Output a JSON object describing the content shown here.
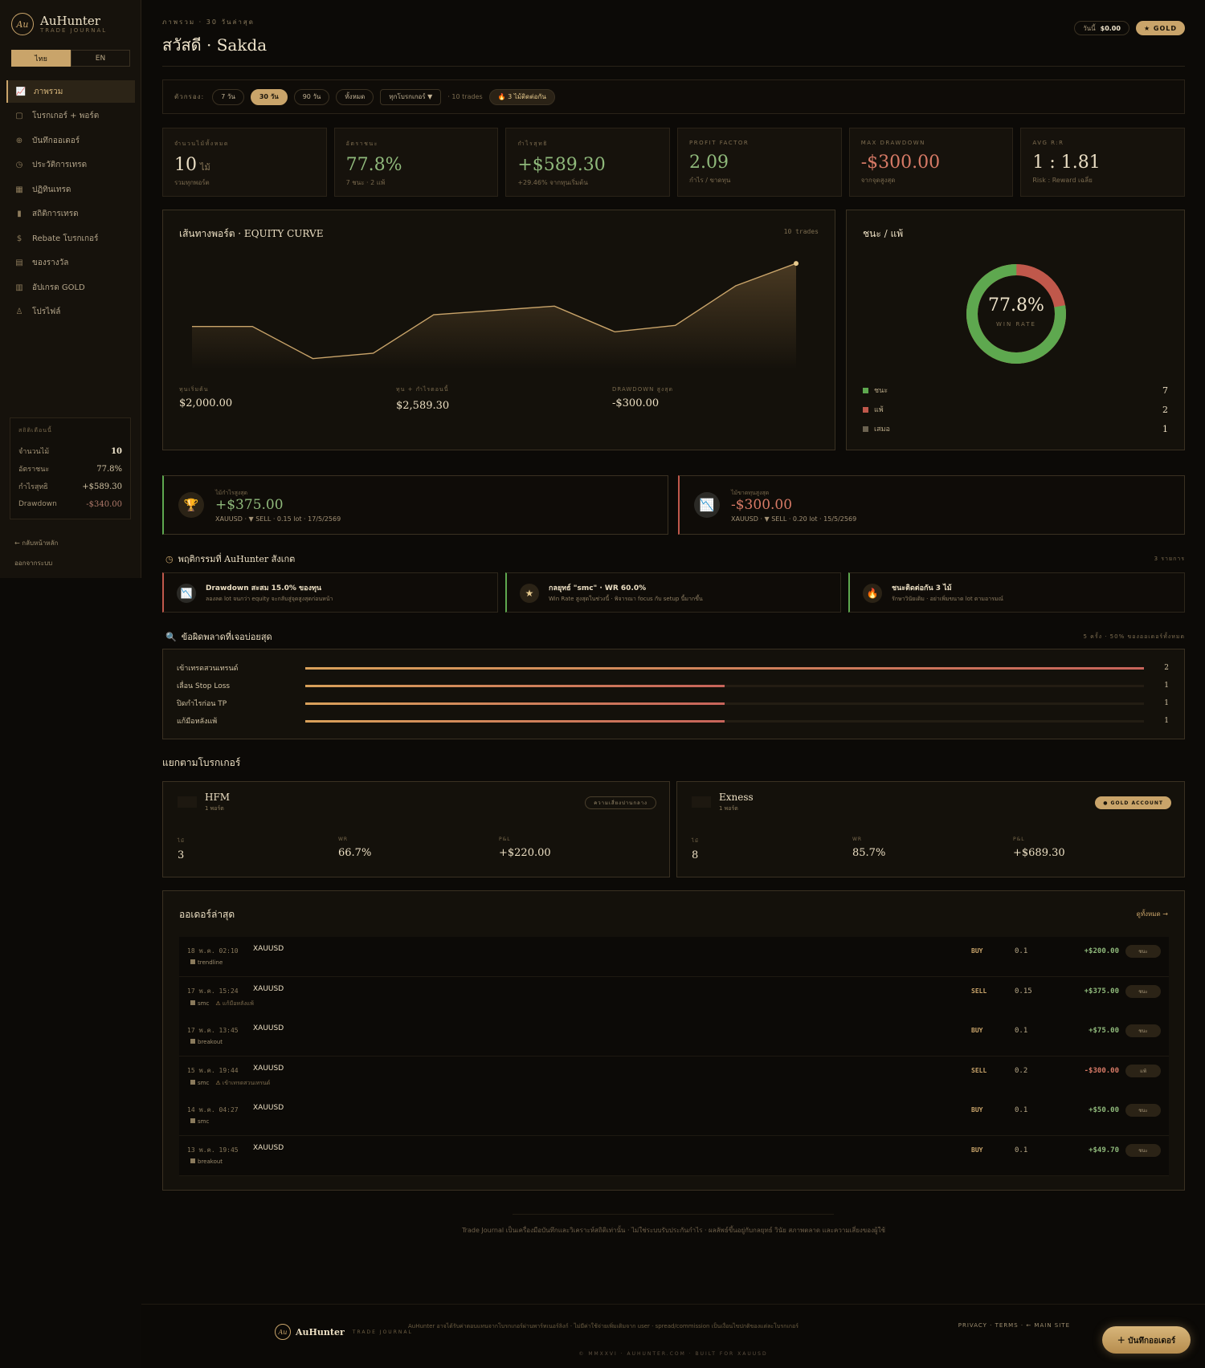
{
  "brand": {
    "name": "AuHunter",
    "sub": "TRADE JOURNAL",
    "logo": "Au"
  },
  "lang": {
    "th": "ไทย",
    "en": "EN"
  },
  "nav": [
    {
      "label": "ภาพรวม",
      "icon": "chart-line-icon",
      "glyph": "📈"
    },
    {
      "label": "โบรกเกอร์ + พอร์ต",
      "icon": "briefcase-icon",
      "glyph": "▢"
    },
    {
      "label": "บันทึกออเดอร์",
      "icon": "plus-circle-icon",
      "glyph": "⊕"
    },
    {
      "label": "ประวัติการเทรด",
      "icon": "clock-icon",
      "glyph": "◷"
    },
    {
      "label": "ปฏิทินเทรด",
      "icon": "calendar-icon",
      "glyph": "▦"
    },
    {
      "label": "สถิติการเทรด",
      "icon": "bar-chart-icon",
      "glyph": "▮"
    },
    {
      "label": "Rebate โบรกเกอร์",
      "icon": "dollar-circle-icon",
      "glyph": "$"
    },
    {
      "label": "ของรางวัล",
      "icon": "gift-icon",
      "glyph": "▤"
    },
    {
      "label": "อัปเกรด GOLD",
      "icon": "upgrade-gift-icon",
      "glyph": "▥"
    },
    {
      "label": "โปรไฟล์",
      "icon": "user-icon",
      "glyph": "♙"
    }
  ],
  "side_stats": {
    "title": "สถิติเดือนนี้",
    "rows": [
      {
        "k": "จำนวนไม้",
        "v": "10"
      },
      {
        "k": "อัตราชนะ",
        "v": "77.8%"
      },
      {
        "k": "กำไรสุทธิ",
        "v": "+$589.30"
      },
      {
        "k": "Drawdown",
        "v": "-$340.00"
      }
    ]
  },
  "side_links": {
    "back": "← กลับหน้าหลัก",
    "logout": "ออกจากระบบ"
  },
  "header": {
    "crumb": "ภาพรวม · 30 วันล่าสุด",
    "title": "สวัสดี · Sakda",
    "balance_label": "วันนี้",
    "balance": "$0.00",
    "tier": "★ GOLD"
  },
  "filters": {
    "label": "ตัวกรอง:",
    "ranges": [
      "7 วัน",
      "30 วัน",
      "90 วัน",
      "ทั้งหมด"
    ],
    "broker": "ทุกโบรกเกอร์ ▼",
    "count": "· 10 trades",
    "streak": "🔥 3 ไม้ติดต่อกัน"
  },
  "kpis": [
    {
      "label": "จำนวนไม้ทั้งหมด",
      "value": "10",
      "unit": "ไม้",
      "sub": "รวมทุกพอร์ต"
    },
    {
      "label": "อัตราชนะ",
      "value": "77.8%",
      "unit": "",
      "sub": "7 ชนะ · 2 แพ้"
    },
    {
      "label": "กำไรสุทธิ",
      "value": "+$589.30",
      "unit": "",
      "sub": "+29.46% จากทุนเริ่มต้น"
    },
    {
      "label": "PROFIT FACTOR",
      "value": "2.09",
      "unit": "",
      "sub": "กำไร / ขาดทุน"
    },
    {
      "label": "MAX DRAWDOWN",
      "value": "-$300.00",
      "unit": "",
      "sub": "จากจุดสูงสุด"
    },
    {
      "label": "AVG R:R",
      "value": "1 : 1.81",
      "unit": "",
      "sub": "Risk : Reward เฉลี่ย"
    }
  ],
  "equity": {
    "title": "เส้นทางพอร์ต · EQUITY CURVE",
    "count": "10 trades",
    "start_label": "ทุนเริ่มต้น",
    "start": "$2,000.00",
    "now_label": "ทุน + กำไรตอนนี้",
    "now": "$2,589.30",
    "dd_label": "DRAWDOWN สูงสุด",
    "dd": "-$300.00"
  },
  "chart_data": {
    "type": "area",
    "series": [
      {
        "values": [
          2000,
          2000,
          1700,
          1750,
          2110,
          2150,
          2190,
          1950,
          2010,
          2380,
          2589.3
        ]
      }
    ]
  },
  "winloss": {
    "title": "ชนะ / แพ้",
    "pct": "77.8%",
    "pct_label": "WIN RATE",
    "win_fraction": 0.778,
    "colors": {
      "win": "#5ea84f",
      "loss": "#c0584b",
      "draw": "#6b6250"
    },
    "rows": [
      {
        "k": "ชนะ",
        "v": "7"
      },
      {
        "k": "แพ้",
        "v": "2"
      },
      {
        "k": "เสมอ",
        "v": "1"
      }
    ]
  },
  "best": {
    "label": "ไม้กำไรสูงสุด",
    "value": "+$375.00",
    "sub": "XAUUSD · ▼ SELL · 0.15 lot · 17/5/2569"
  },
  "worst": {
    "label": "ไม้ขาดทุนสูงสุด",
    "value": "-$300.00",
    "sub": "XAUUSD · ▼ SELL · 0.20 lot · 15/5/2569"
  },
  "behavior": {
    "title": "พฤติกรรมที่ AuHunter สังเกต",
    "count": "3 รายการ",
    "items": [
      {
        "t": "Drawdown สะสม 15.0% ของทุน",
        "s": "ลองลด lot จนกว่า equity จะกลับสู่จุดสูงสุดก่อนหน้า"
      },
      {
        "t": "กลยุทธ์ \"smc\" · WR 60.0%",
        "s": "Win Rate สูงสุดในช่วงนี้ · พิจารณา focus กับ setup นี้มากขึ้น"
      },
      {
        "t": "ชนะติดต่อกัน 3 ไม้",
        "s": "รักษาวินัยเดิม · อย่าเพิ่มขนาด lot ตามอารมณ์"
      }
    ]
  },
  "mistakes": {
    "title": "ข้อผิดพลาดที่เจอบ่อยสุด",
    "count": "5 ครั้ง · 50% ของออเดอร์ทั้งหมด",
    "rows": [
      {
        "k": "เข้าเทรดสวนเทรนด์",
        "v": "2",
        "frac": 1.0
      },
      {
        "k": "เลื่อน Stop Loss",
        "v": "1",
        "frac": 0.5
      },
      {
        "k": "ปิดกำไรก่อน TP",
        "v": "1",
        "frac": 0.5
      },
      {
        "k": "แก้มือหลังแพ้",
        "v": "1",
        "frac": 0.5
      }
    ]
  },
  "brokers": {
    "title": "แยกตามโบรกเกอร์",
    "items": [
      {
        "name": "HFM",
        "ports": "1 พอร์ต",
        "tag": "ความเสี่ยงปานกลาง",
        "trades_label": "ไม้",
        "trades": "3",
        "wr_label": "WR",
        "wr": "66.7%",
        "pl_label": "P&L",
        "pl": "+$220.00"
      },
      {
        "name": "Exness",
        "ports": "1 พอร์ต",
        "tag": "● GOLD ACCOUNT",
        "trades_label": "ไม้",
        "trades": "8",
        "wr_label": "WR",
        "wr": "85.7%",
        "pl_label": "P&L",
        "pl": "+$689.30"
      }
    ]
  },
  "orders": {
    "title": "ออเดอร์ล่าสุด",
    "all": "ดูทั้งหมด →",
    "rows": [
      {
        "date": "18 พ.ค. 02:10",
        "sym": "XAUUSD",
        "tag": "trendline",
        "warn": "",
        "side": "BUY",
        "lot": "0.1",
        "pnl": "+$200.00",
        "res": "ชนะ"
      },
      {
        "date": "17 พ.ค. 15:24",
        "sym": "XAUUSD",
        "tag": "smc",
        "warn": "แก้มือหลังแพ้",
        "side": "SELL",
        "lot": "0.15",
        "pnl": "+$375.00",
        "res": "ชนะ"
      },
      {
        "date": "17 พ.ค. 13:45",
        "sym": "XAUUSD",
        "tag": "breakout",
        "warn": "",
        "side": "BUY",
        "lot": "0.1",
        "pnl": "+$75.00",
        "res": "ชนะ"
      },
      {
        "date": "15 พ.ค. 19:44",
        "sym": "XAUUSD",
        "tag": "smc",
        "warn": "เข้าเทรดสวนเทรนด์",
        "side": "SELL",
        "lot": "0.2",
        "pnl": "-$300.00",
        "res": "แพ้"
      },
      {
        "date": "14 พ.ค. 04:27",
        "sym": "XAUUSD",
        "tag": "smc",
        "warn": "",
        "side": "BUY",
        "lot": "0.1",
        "pnl": "+$50.00",
        "res": "ชนะ"
      },
      {
        "date": "13 พ.ค. 19:45",
        "sym": "XAUUSD",
        "tag": "breakout",
        "warn": "",
        "side": "BUY",
        "lot": "0.1",
        "pnl": "+$49.70",
        "res": "ชนะ"
      }
    ]
  },
  "disclaimer": "Trade Journal เป็นเครื่องมือบันทึกและวิเคราะห์สถิติเท่านั้น · ไม่ใช่ระบบรับประกันกำไร · ผลลัพธ์ขึ้นอยู่กับกลยุทธ์ วินัย สภาพตลาด และความเสี่ยงของผู้ใช้",
  "footer": {
    "name": "AuHunter",
    "sub": "TRADE JOURNAL",
    "note": "AuHunter อาจได้รับค่าตอบแทนจากโบรกเกอร์ผ่านพาร์ทเนอร์ลิงก์ · ไม่มีค่าใช้จ่ายเพิ่มเติมจาก user · spread/commission เป็นเงื่อนไขปกติของแต่ละโบรกเกอร์",
    "links": "PRIVACY · TERMS · ← MAIN SITE",
    "copy": "© MMXXVI · AUHUNTER.COM · BUILT FOR XAUUSD"
  },
  "fab": "＋ บันทึกออเดอร์"
}
